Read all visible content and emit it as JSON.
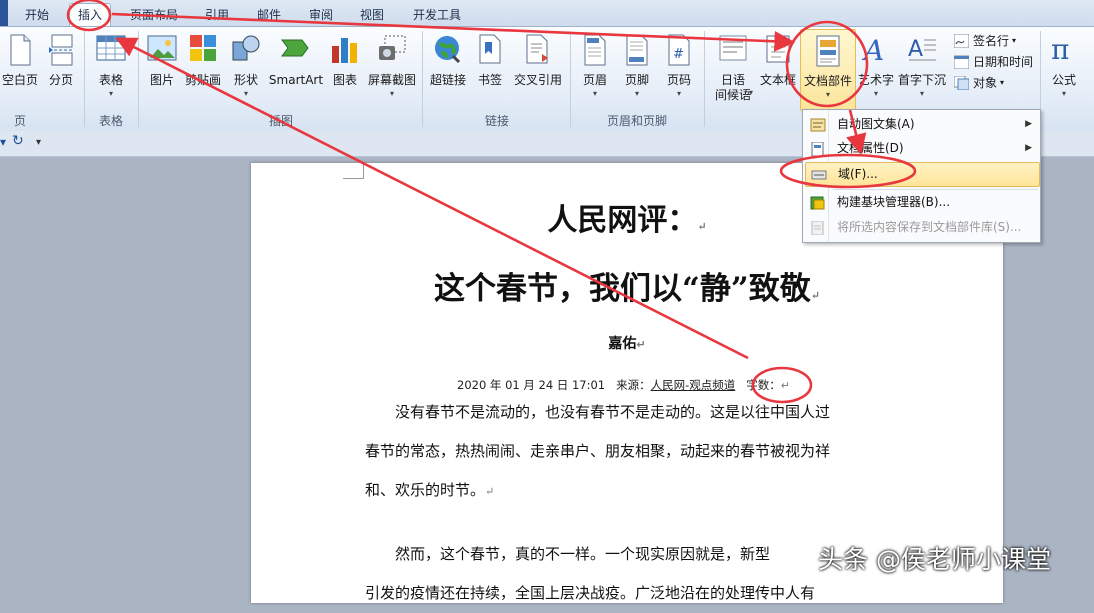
{
  "tabs": [
    "开始",
    "插入",
    "页面布局",
    "引用",
    "邮件",
    "审阅",
    "视图",
    "开发工具"
  ],
  "active_tab": "插入",
  "ribbon": {
    "pages": {
      "blank_page": "空白页",
      "page_break": "分页",
      "group": "页"
    },
    "tables": {
      "table": "表格",
      "group": "表格"
    },
    "illustrations": {
      "picture": "图片",
      "clipart": "剪贴画",
      "shapes": "形状",
      "smartart": "SmartArt",
      "chart": "图表",
      "screenshot": "屏幕截图",
      "group": "插图"
    },
    "links": {
      "hyperlink": "超链接",
      "bookmark": "书签",
      "crossref": "交叉引用",
      "group": "链接"
    },
    "header_footer": {
      "header": "页眉",
      "footer": "页脚",
      "page_number": "页码",
      "group": "页眉和页脚"
    },
    "text": {
      "phonetic": "日语\n间候语",
      "phonetic_1": "日语",
      "phonetic_2": "间候语",
      "textbox": "文本框",
      "quickparts": "文档部件",
      "wordart": "艺术字",
      "dropcap": "首字下沉",
      "signature": "签名行",
      "datetime": "日期和时间",
      "object": "对象"
    },
    "symbols": {
      "equation": "公式"
    }
  },
  "menu": {
    "items": [
      {
        "label": "自动图文集(A)",
        "submenu": true
      },
      {
        "label": "文档属性(D)",
        "submenu": true
      },
      {
        "label": "域(F)...",
        "highlighted": true
      },
      {
        "label": "构建基块管理器(B)..."
      },
      {
        "label": "将所选内容保存到文档部件库(S)...",
        "disabled": true
      }
    ]
  },
  "document": {
    "title_line1": "人民网评：",
    "title_line2": "这个春节，我们以“静”致敬",
    "author": "嘉佑",
    "date": "2020 年 01 月 24 日 17:01",
    "source_label": "来源：",
    "source": "人民网-观点频道",
    "wordcount_label": "字数：",
    "para1_line1": "没有春节不是流动的，也没有春节不是走动的。这是以往中国人过",
    "para1_line2": "春节的常态，热热闹闹、走亲串户、朋友相聚，动起来的春节被视为祥",
    "para1_line3": "和、欢乐的时节。",
    "para2_line1": "然而，这个春节，真的不一样。一个现实原因就是，新型",
    "para2_line2": "引发的疫情还在持续，全国上层决战疫。广泛地沿在的处理传中人有"
  },
  "watermark": "头条 @侯老师小课堂",
  "colors": {
    "annotation": "#e8373f",
    "accent": "#2a5599",
    "highlight": "#fde497"
  }
}
